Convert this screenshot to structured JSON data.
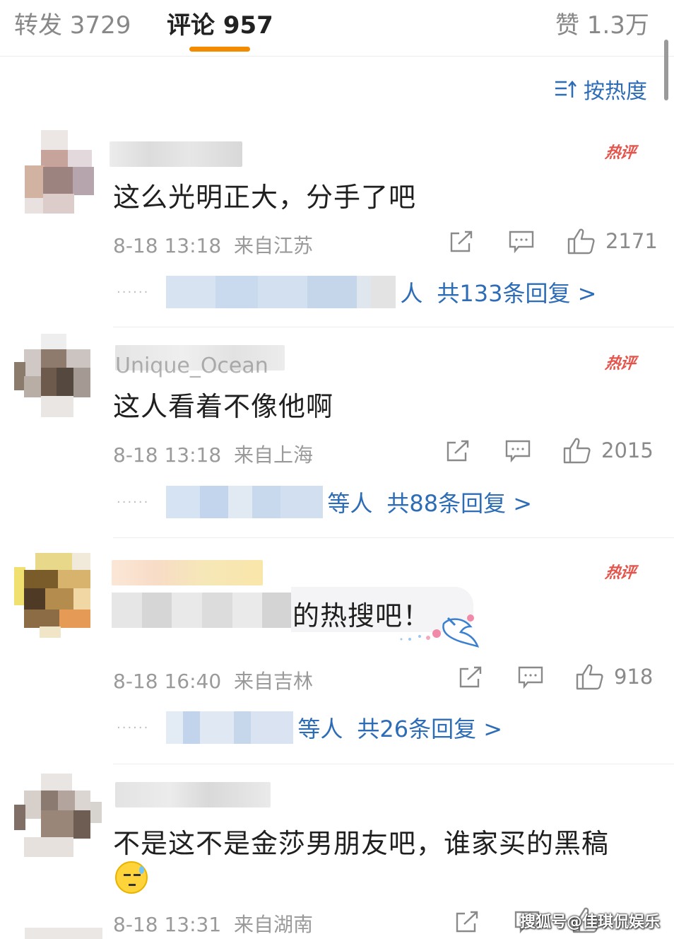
{
  "tabs": {
    "repost": "转发 3729",
    "comments": "评论 957",
    "likes": "赞 1.3万"
  },
  "sort": {
    "label": "按热度"
  },
  "hot_badge": "热评",
  "colors": {
    "accent": "#f38b00",
    "link": "#2d6cb6",
    "hot": "#e5534b"
  },
  "comments": [
    {
      "text": "这么光明正大，分手了吧",
      "time": "8-18 13:18",
      "location": "来自江苏",
      "likes": "2171",
      "reply_prefix": "人",
      "reply_summary": "共133条回复 >"
    },
    {
      "username_partial": "Unique_Ocean",
      "text": "这人看着不像他啊",
      "time": "8-18 13:18",
      "location": "来自上海",
      "likes": "2015",
      "reply_prefix": "等人",
      "reply_summary": "共88条回复 >"
    },
    {
      "text": "的热搜吧！",
      "time": "8-18 16:40",
      "location": "来自吉林",
      "likes": "918",
      "reply_prefix": "等人",
      "reply_summary": "共26条回复 >"
    },
    {
      "text": "不是这不是金莎男朋友吧，谁家买的黑稿",
      "time": "8-18 13:31",
      "location": "来自湖南",
      "likes": ""
    }
  ],
  "watermark": "搜狐号@佳琪侃娱乐"
}
